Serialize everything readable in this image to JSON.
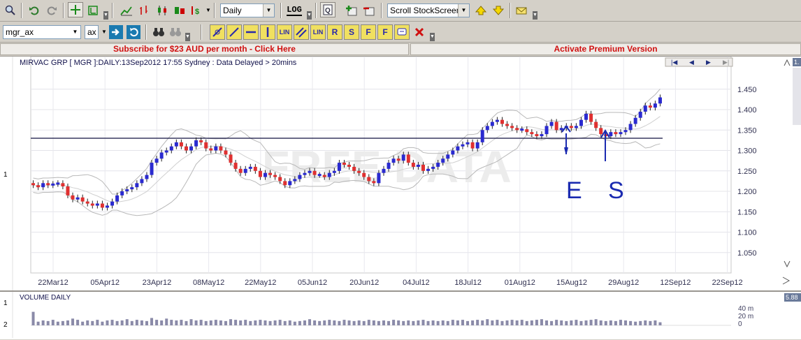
{
  "toolbar": {
    "interval": "Daily",
    "log_label": "LOG",
    "screen_select": "Scroll StockScreen"
  },
  "toolbar2": {
    "symbol": "mgr_ax",
    "exchange": "ax",
    "drawing_labels": [
      "LIN",
      "LIN",
      "R",
      "S",
      "F",
      "F"
    ]
  },
  "banner": {
    "subscribe": "Subscribe for $23 AUD per month - Click Here",
    "premium": "Activate Premium Version"
  },
  "chart_data": {
    "type": "candlestick",
    "title": "MIRVAC GRP [ MGR ]:DAILY:13Sep2012 17:55 Sydney : Data Delayed > 20mins",
    "watermark": "FREE DATA",
    "x_ticks": [
      "22Mar12",
      "05Apr12",
      "23Apr12",
      "08May12",
      "22May12",
      "05Jun12",
      "20Jun12",
      "04Jul12",
      "18Jul12",
      "01Aug12",
      "15Aug12",
      "29Aug12",
      "12Sep12",
      "22Sep12"
    ],
    "y_ticks": [
      "1.450",
      "1.400",
      "1.350",
      "1.300",
      "1.250",
      "1.200",
      "1.150",
      "1.100",
      "1.050"
    ],
    "ylim": [
      1.0,
      1.53
    ],
    "left_axis_label": "1",
    "horizontal_line": 1.33,
    "series": [
      {
        "values": [
          1.215,
          1.21,
          1.22,
          1.215,
          1.218,
          1.22,
          1.212,
          1.19,
          1.18,
          1.185,
          1.175,
          1.17,
          1.165,
          1.17,
          1.16,
          1.165,
          1.175,
          1.19,
          1.2,
          1.205,
          1.21,
          1.22,
          1.23,
          1.24,
          1.27,
          1.28,
          1.295,
          1.3,
          1.31,
          1.32,
          1.31,
          1.3,
          1.31,
          1.325,
          1.32,
          1.305,
          1.3,
          1.31,
          1.3,
          1.29,
          1.27,
          1.255,
          1.245,
          1.255,
          1.26,
          1.25,
          1.235,
          1.245,
          1.24,
          1.235,
          1.225,
          1.215,
          1.225,
          1.23,
          1.24,
          1.245,
          1.25,
          1.24,
          1.24,
          1.235,
          1.245,
          1.25,
          1.27,
          1.265,
          1.26,
          1.25,
          1.245,
          1.235,
          1.225,
          1.22,
          1.245,
          1.255,
          1.27,
          1.28,
          1.275,
          1.29,
          1.27,
          1.26,
          1.265,
          1.25,
          1.255,
          1.26,
          1.27,
          1.28,
          1.29,
          1.3,
          1.31,
          1.315,
          1.32,
          1.305,
          1.32,
          1.35,
          1.36,
          1.37,
          1.375,
          1.365,
          1.36,
          1.355,
          1.35,
          1.352,
          1.345,
          1.34,
          1.335,
          1.34,
          1.36,
          1.37,
          1.35,
          1.355,
          1.36,
          1.355,
          1.36,
          1.375,
          1.39,
          1.37,
          1.355,
          1.34,
          1.335,
          1.345,
          1.34,
          1.345,
          1.35,
          1.365,
          1.38,
          1.395,
          1.41,
          1.405,
          1.415,
          1.43
        ]
      }
    ]
  },
  "annotations": {
    "e": "E",
    "s": "S"
  },
  "volume": {
    "title": "VOLUME DAILY",
    "y_ticks": [
      "40 m",
      "20 m",
      "0"
    ],
    "left_labels": [
      "1",
      "2"
    ],
    "corner_value": "5.88",
    "values": [
      22,
      6,
      8,
      7,
      9,
      6,
      7,
      8,
      11,
      9,
      6,
      8,
      7,
      9,
      6,
      8,
      9,
      7,
      8,
      10,
      7,
      9,
      8,
      7,
      12,
      9,
      8,
      11,
      9,
      8,
      9,
      7,
      10,
      8,
      9,
      7,
      8,
      9,
      8,
      7,
      10,
      9,
      8,
      9,
      7,
      8,
      9,
      8,
      7,
      8,
      9,
      7,
      8,
      6,
      7,
      8,
      10,
      8,
      7,
      8,
      9,
      8,
      7,
      9,
      8,
      7,
      8,
      7,
      9,
      8,
      7,
      8,
      7,
      9,
      8,
      7,
      8,
      7,
      8,
      9,
      7,
      8,
      7,
      8,
      7,
      9,
      8,
      9,
      7,
      8,
      9,
      8,
      10,
      8,
      9,
      7,
      8,
      9,
      8,
      9,
      7,
      8,
      9,
      10,
      8,
      7,
      9,
      8,
      7,
      8,
      9,
      7,
      8,
      9,
      10,
      8,
      7,
      8,
      7,
      9,
      8,
      7,
      6,
      7,
      8,
      7,
      8,
      5
    ]
  },
  "side_scale": {
    "top_value": "1."
  },
  "nav_buttons": [
    "|◀",
    "◀",
    "▶",
    "▶|"
  ]
}
